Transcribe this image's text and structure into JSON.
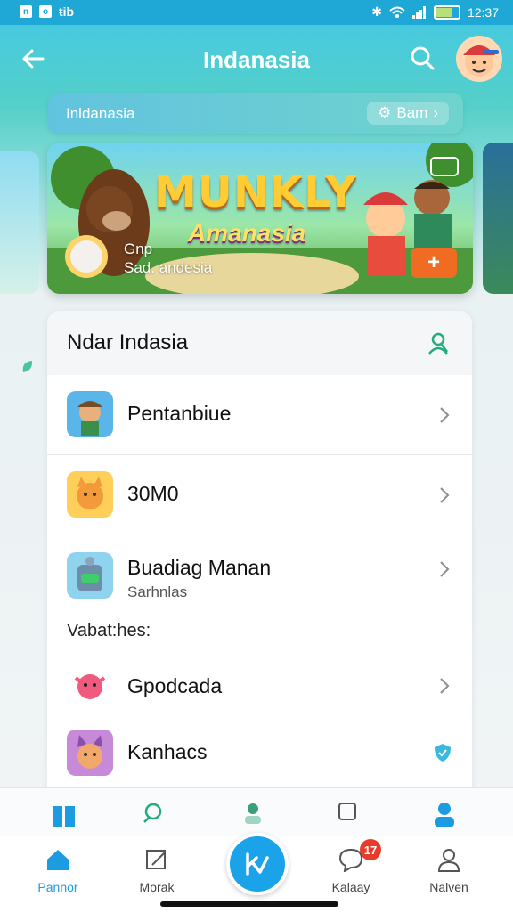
{
  "status_bar": {
    "time": "12:37",
    "left_glyph": "ŧib"
  },
  "header": {
    "title": "Indanasia"
  },
  "search": {
    "value": "Inldanasia",
    "button_label": "Bam"
  },
  "banner": {
    "logo_main": "MUNKLY",
    "logo_sub": "Amanasia",
    "subtitle": "Gnp",
    "name": "Sad. andesia",
    "add_label": "+"
  },
  "list_card": {
    "title": "Ndar Indasia",
    "items": [
      {
        "label": "Pentanbiue"
      },
      {
        "label": "30M0"
      },
      {
        "label": "Buadiag Manan",
        "sublabel": "Sarhnlas"
      }
    ],
    "section_label": "Vabat:hes:",
    "section_items": [
      {
        "label": "Gpodcada"
      },
      {
        "label": "Kanhacs"
      }
    ]
  },
  "bottom_nav": {
    "tabs": [
      {
        "label": "Pannor"
      },
      {
        "label": "Morak"
      },
      {
        "label": "Kalaay"
      },
      {
        "label": "Nalven"
      }
    ],
    "badge": "17"
  },
  "colors": {
    "accent": "#1d9be0",
    "header_start": "#43c8e6",
    "header_end": "#54d0c8",
    "add_button": "#f06c22",
    "badge": "#e83b2a"
  }
}
